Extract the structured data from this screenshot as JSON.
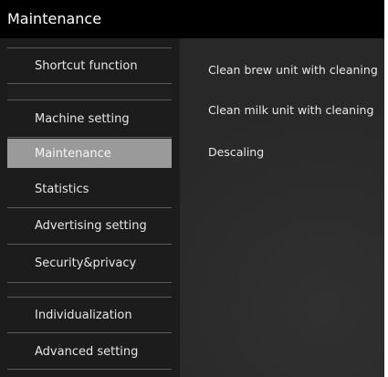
{
  "window": {
    "title": "Maintenance"
  },
  "sidebar": {
    "items": [
      {
        "label": "Shortcut function"
      },
      {
        "label": "Machine setting"
      },
      {
        "label": "Maintenance",
        "active": true
      },
      {
        "label": "Statistics"
      },
      {
        "label": "Advertising setting"
      },
      {
        "label": "Security&privacy"
      },
      {
        "label": "Individualization"
      },
      {
        "label": "Advanced setting"
      }
    ]
  },
  "main": {
    "items": [
      {
        "label": "Clean brew unit with cleaning"
      },
      {
        "label": "Clean milk unit with cleaning"
      },
      {
        "label": "Descaling"
      }
    ]
  },
  "colors": {
    "titlebar": "#000000",
    "sidebar": "#1c1c1c",
    "active_item": "#9a9a9a",
    "content": "#2c2c2c",
    "text": "#e6e6e6"
  }
}
